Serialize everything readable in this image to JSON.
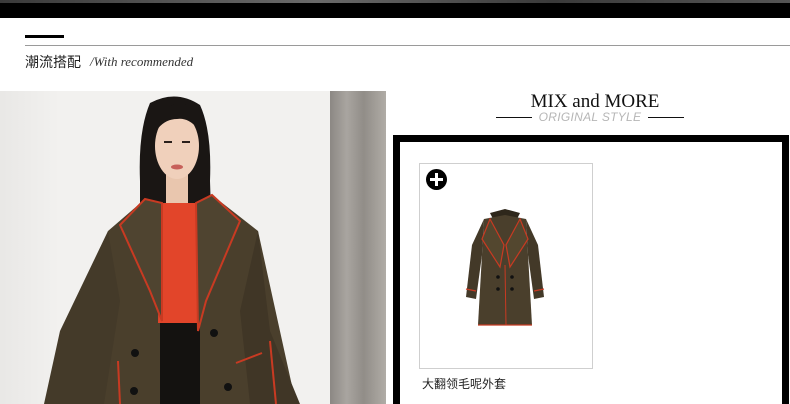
{
  "section": {
    "title": "潮流搭配",
    "subtitle": "/With recommended"
  },
  "mix_panel": {
    "title": "MIX and MORE",
    "subtitle": "ORIGINAL STYLE"
  },
  "product": {
    "name": "大翻领毛呢外套",
    "add_icon": "plus-circle-icon"
  },
  "colors": {
    "coat": "#4a3f2c",
    "piping": "#c83a22",
    "blouse": "#e2452a",
    "frame": "#000000"
  }
}
